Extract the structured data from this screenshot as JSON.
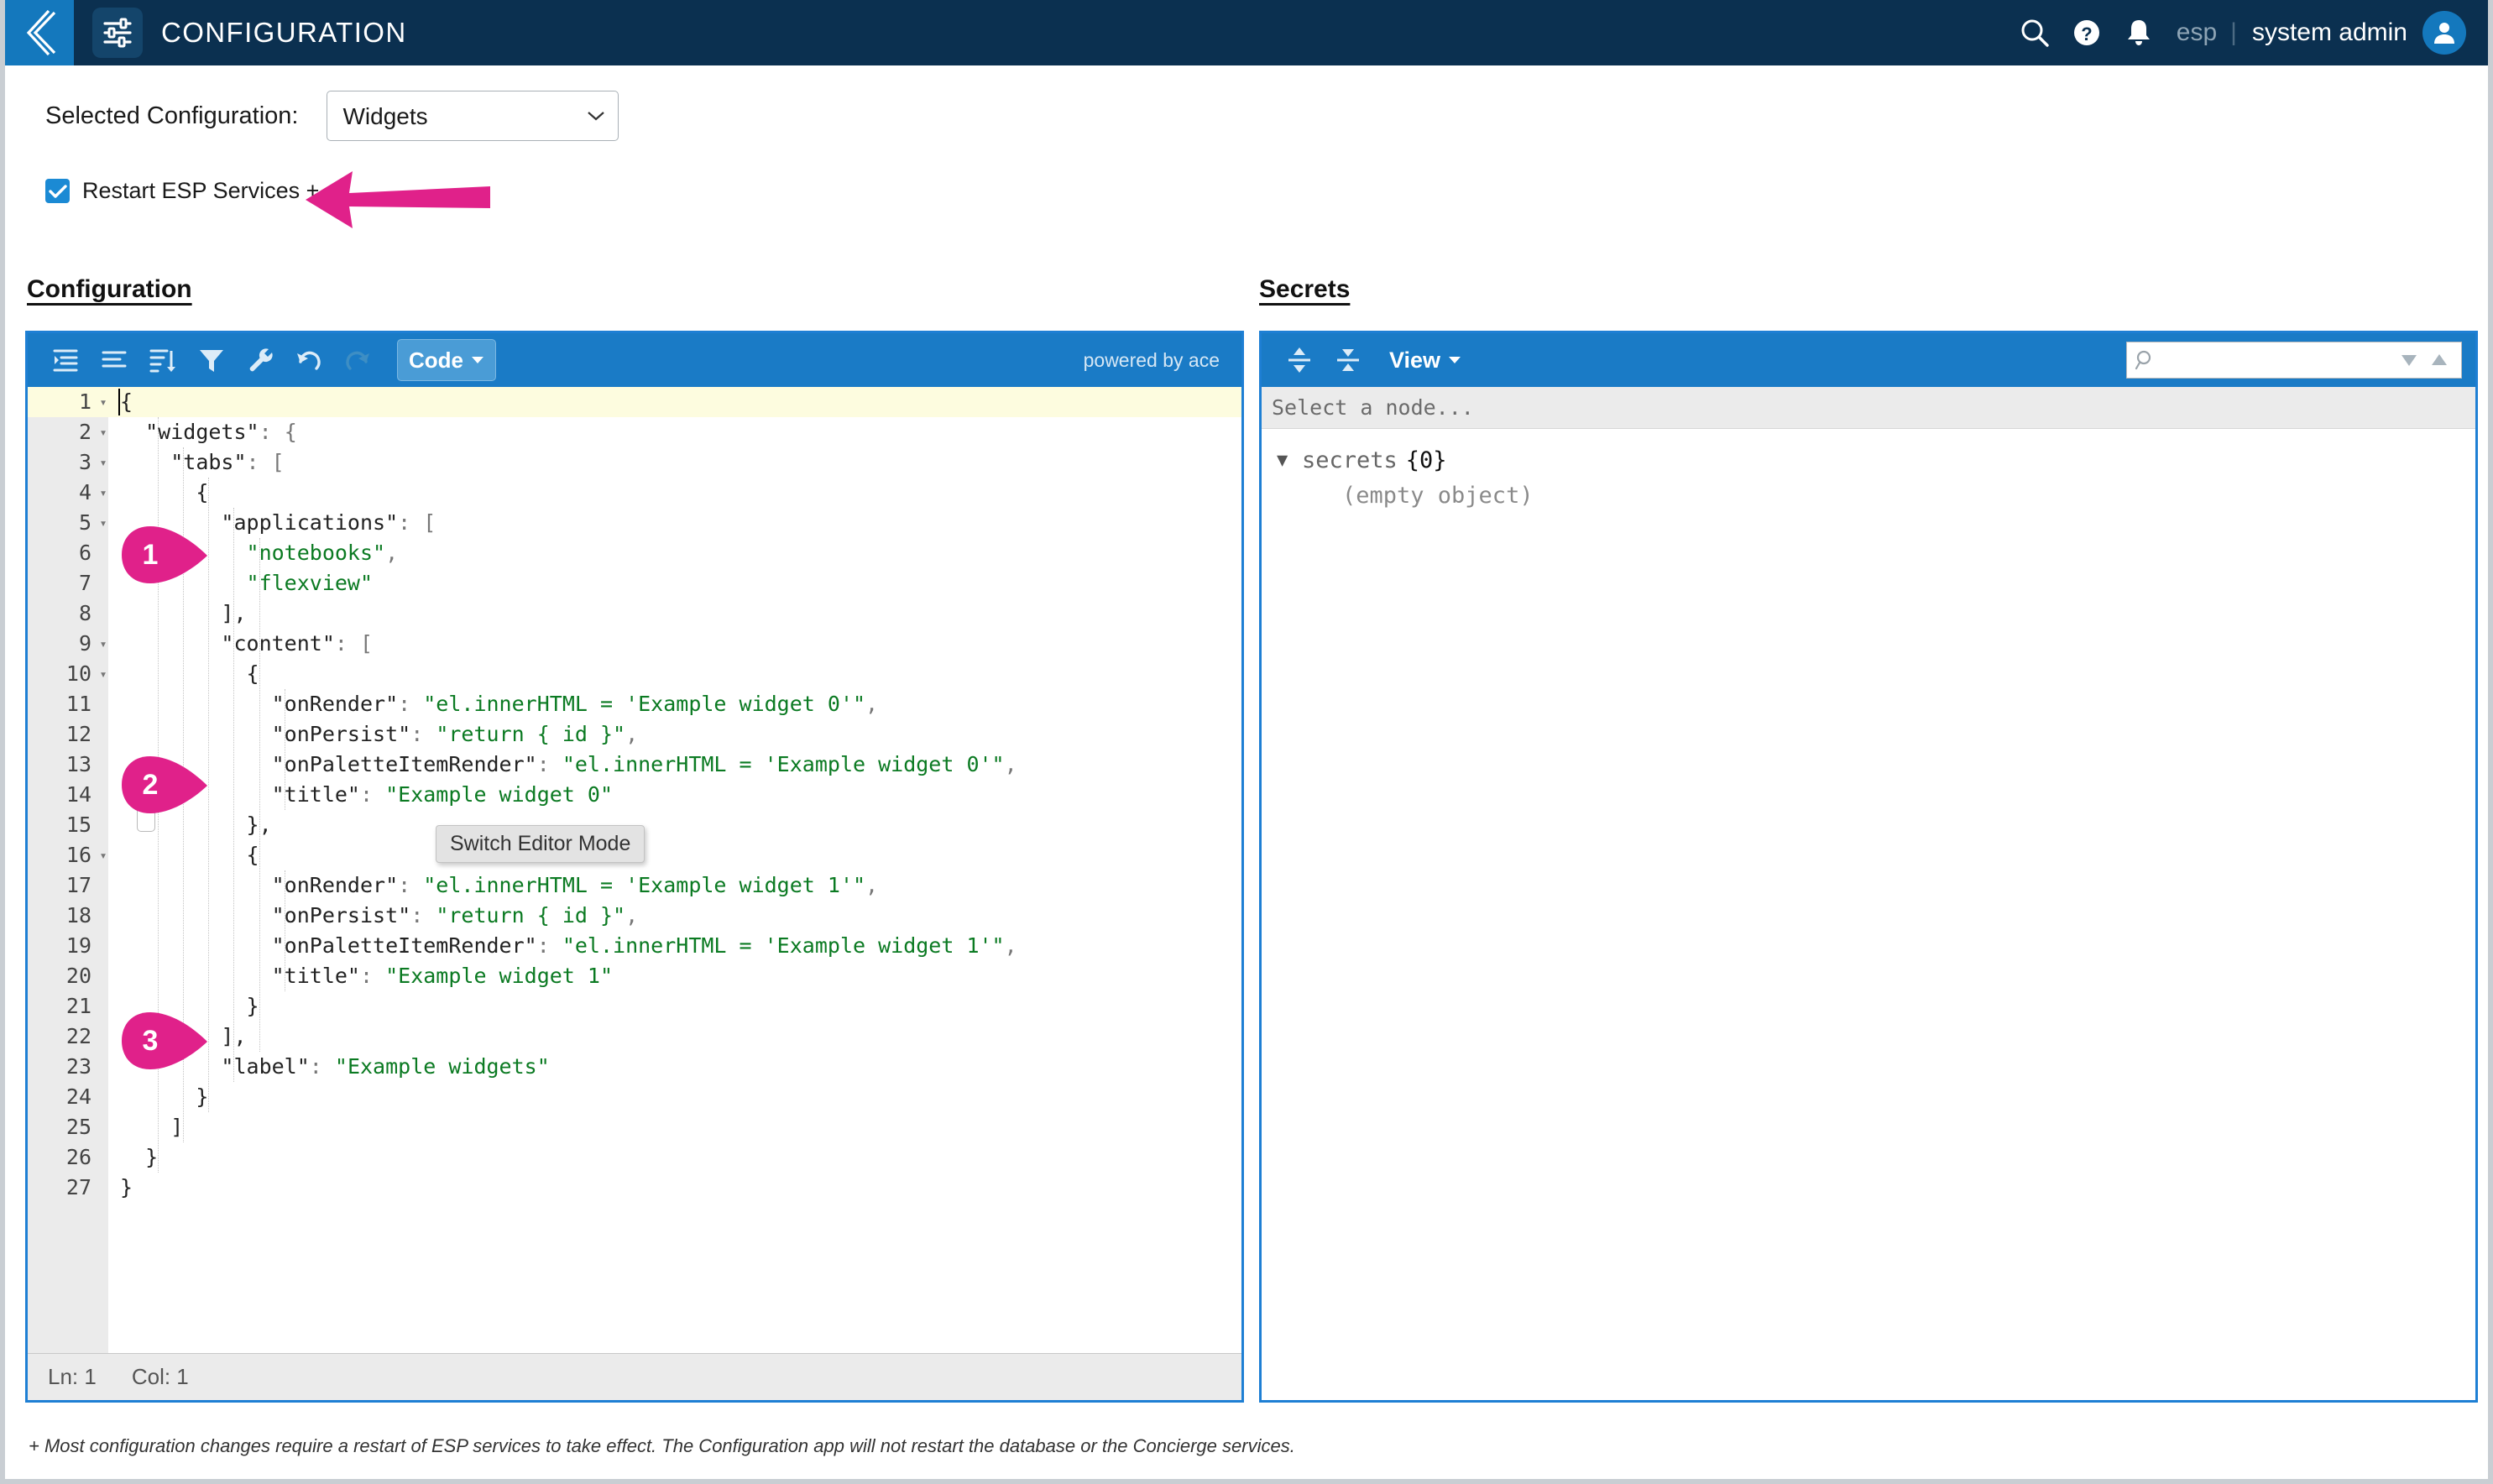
{
  "header": {
    "back_icon": "back-chevron-icon",
    "app_icon": "sliders-configuration-icon",
    "title": "CONFIGURATION",
    "search_icon": "search-icon",
    "help_icon": "help-question-icon",
    "notifications_icon": "bell-icon",
    "tenant": "esp",
    "separator": "|",
    "username": "system admin",
    "avatar_icon": "user-avatar-icon"
  },
  "controls": {
    "selected_configuration_label": "Selected Configuration:",
    "selected_configuration_value": "Widgets",
    "configuration_options": [
      "Widgets"
    ],
    "dropdown_caret_icon": "chevron-down-icon",
    "restart_checkbox_label": "Restart ESP Services +",
    "restart_checkbox_checked": true,
    "annotation_arrow": "pink-left-arrow"
  },
  "sections": {
    "configuration_title": "Configuration",
    "secrets_title": "Secrets"
  },
  "editor": {
    "toolbar": {
      "indent_icon": "indent-lines-icon",
      "format_icon": "compact-lines-icon",
      "sort_icon": "sort-lines-icon",
      "filter_icon": "filter-funnel-icon",
      "repair_icon": "wrench-icon",
      "undo_icon": "undo-arrow-icon",
      "redo_icon": "redo-arrow-icon",
      "mode_button_label": "Code",
      "mode_button_caret": "caret-down-icon",
      "powered_by": "powered by ace"
    },
    "tooltip": "Switch Editor Mode",
    "status": {
      "line": "Ln: 1",
      "column": "Col: 1"
    },
    "lines": [
      {
        "n": "1",
        "fold": "▾",
        "indent": 0,
        "text": "{",
        "type": "plain",
        "active": true
      },
      {
        "n": "2",
        "fold": "▾",
        "indent": 1,
        "key": "\"widgets\"",
        "sep": ": ",
        "tail": "{"
      },
      {
        "n": "3",
        "fold": "▾",
        "indent": 2,
        "key": "\"tabs\"",
        "sep": ": ",
        "tail": "["
      },
      {
        "n": "4",
        "fold": "▾",
        "indent": 3,
        "text": "{",
        "type": "plain"
      },
      {
        "n": "5",
        "fold": "▾",
        "indent": 4,
        "key": "\"applications\"",
        "sep": ": ",
        "tail": "["
      },
      {
        "n": "6",
        "fold": "",
        "indent": 5,
        "str": "\"notebooks\"",
        "tail": ","
      },
      {
        "n": "7",
        "fold": "",
        "indent": 5,
        "str": "\"flexview\""
      },
      {
        "n": "8",
        "fold": "",
        "indent": 4,
        "text": "],",
        "type": "plain"
      },
      {
        "n": "9",
        "fold": "▾",
        "indent": 4,
        "key": "\"content\"",
        "sep": ": ",
        "tail": "["
      },
      {
        "n": "10",
        "fold": "▾",
        "indent": 5,
        "text": "{",
        "type": "plain"
      },
      {
        "n": "11",
        "fold": "",
        "indent": 6,
        "key": "\"onRender\"",
        "sep": ": ",
        "str": "\"el.innerHTML = 'Example widget 0'\"",
        "tail": ","
      },
      {
        "n": "12",
        "fold": "",
        "indent": 6,
        "key": "\"onPersist\"",
        "sep": ": ",
        "str": "\"return { id }\"",
        "tail": ","
      },
      {
        "n": "13",
        "fold": "",
        "indent": 6,
        "key": "\"onPaletteItemRender\"",
        "sep": ": ",
        "str": "\"el.innerHTML = 'Example widget 0'\"",
        "tail": ","
      },
      {
        "n": "14",
        "fold": "",
        "indent": 6,
        "key": "\"title\"",
        "sep": ": ",
        "str": "\"Example widget 0\""
      },
      {
        "n": "15",
        "fold": "",
        "indent": 5,
        "text": "},",
        "type": "plain"
      },
      {
        "n": "16",
        "fold": "▾",
        "indent": 5,
        "text": "{",
        "type": "plain"
      },
      {
        "n": "17",
        "fold": "",
        "indent": 6,
        "key": "\"onRender\"",
        "sep": ": ",
        "str": "\"el.innerHTML = 'Example widget 1'\"",
        "tail": ","
      },
      {
        "n": "18",
        "fold": "",
        "indent": 6,
        "key": "\"onPersist\"",
        "sep": ": ",
        "str": "\"return { id }\"",
        "tail": ","
      },
      {
        "n": "19",
        "fold": "",
        "indent": 6,
        "key": "\"onPaletteItemRender\"",
        "sep": ": ",
        "str": "\"el.innerHTML = 'Example widget 1'\"",
        "tail": ","
      },
      {
        "n": "20",
        "fold": "",
        "indent": 6,
        "key": "\"title\"",
        "sep": ": ",
        "str": "\"Example widget 1\""
      },
      {
        "n": "21",
        "fold": "",
        "indent": 5,
        "text": "}",
        "type": "plain"
      },
      {
        "n": "22",
        "fold": "",
        "indent": 4,
        "text": "],",
        "type": "plain"
      },
      {
        "n": "23",
        "fold": "",
        "indent": 4,
        "key": "\"label\"",
        "sep": ": ",
        "str": "\"Example widgets\""
      },
      {
        "n": "24",
        "fold": "",
        "indent": 3,
        "text": "}",
        "type": "plain"
      },
      {
        "n": "25",
        "fold": "",
        "indent": 2,
        "text": "]",
        "type": "plain"
      },
      {
        "n": "26",
        "fold": "",
        "indent": 1,
        "text": "}",
        "type": "plain"
      },
      {
        "n": "27",
        "fold": "",
        "indent": 0,
        "text": "}",
        "type": "plain"
      }
    ]
  },
  "secrets": {
    "toolbar": {
      "expand_icon": "expand-all-icon",
      "collapse_icon": "collapse-all-icon",
      "view_button_label": "View",
      "view_button_caret": "caret-down-icon",
      "search_icon": "search-magnifier-icon",
      "search_value": "",
      "search_placeholder": "",
      "prev_icon": "caret-down-nav-icon",
      "next_icon": "caret-up-nav-icon"
    },
    "node_bar_text": "Select a node...",
    "tree": {
      "toggle_icon": "triangle-down-icon",
      "root_label": "secrets",
      "root_count": "{0}",
      "empty_text": "(empty object)"
    }
  },
  "callouts": [
    {
      "number": "1"
    },
    {
      "number": "2"
    },
    {
      "number": "3"
    }
  ],
  "footnote": "+ Most configuration changes require a restart of ESP services to take effect. The Configuration app will not restart the database or the Concierge services.",
  "colors": {
    "header_bg": "#0b3050",
    "accent_blue": "#1478bd",
    "toolbar_blue": "#1a7bc6",
    "annotation_pink": "#e0218a",
    "string_green": "#0b7a22",
    "active_line": "#fdfcdf"
  }
}
